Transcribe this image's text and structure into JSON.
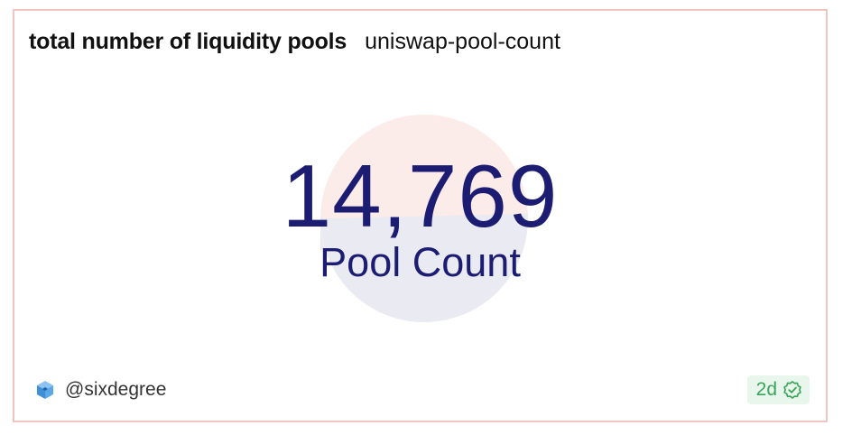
{
  "widget": {
    "title": "total number of liquidity pools",
    "query_name": "uniswap-pool-count",
    "value": "14,769",
    "caption": "Pool Count"
  },
  "footer": {
    "author": "@sixdegree",
    "age_badge": "2d",
    "avatar_icon": "cube-logo-icon",
    "badge_icon": "verified-check-icon"
  },
  "colors": {
    "border": "#f2c4bf",
    "value_text": "#1c1c72",
    "circle_top": "#fcece9",
    "circle_bottom": "#e9eaf2",
    "badge_bg": "#e9f6ec",
    "badge_text": "#3aa55a"
  }
}
